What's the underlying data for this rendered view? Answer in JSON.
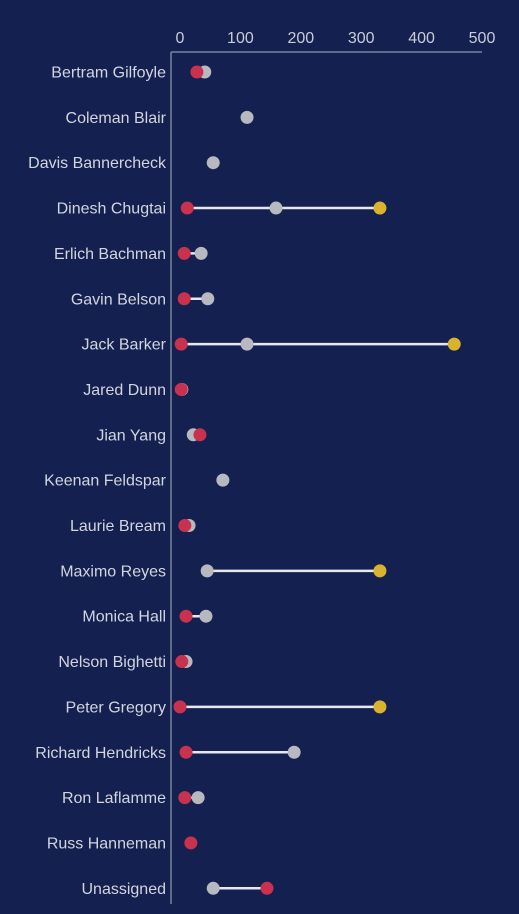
{
  "chart_data": {
    "type": "dumbbell",
    "title": "",
    "xlabel": "",
    "ylabel": "",
    "xlim": [
      0,
      500
    ],
    "x_ticks": [
      "0",
      "100",
      "200",
      "300",
      "400",
      "500"
    ],
    "x_tick_values": [
      0,
      100,
      200,
      300,
      400,
      500
    ],
    "x_axis_position": "top",
    "grid": false,
    "legend": "none",
    "colors": {
      "background": "#142150",
      "red": "#C8324F",
      "grey": "#B7B9C0",
      "gold": "#D9B32E",
      "connector": "#E6E8EE",
      "axis": "#7A849E"
    },
    "series_names": [
      "red",
      "grey",
      "gold"
    ],
    "categories": [
      "Bertram Gilfoyle",
      "Coleman Blair",
      "Davis Bannercheck",
      "Dinesh Chugtai",
      "Erlich Bachman",
      "Gavin Belson",
      "Jack Barker",
      "Jared Dunn",
      "Jian Yang",
      "Keenan Feldspar",
      "Laurie Bream",
      "Maximo Reyes",
      "Monica Hall",
      "Nelson Bighetti",
      "Peter Gregory",
      "Richard Hendricks",
      "Ron Laflamme",
      "Russ Hanneman",
      "Unassigned"
    ],
    "series": [
      {
        "name": "red",
        "values": [
          28,
          null,
          null,
          12,
          7,
          7,
          2,
          2,
          33,
          null,
          8,
          null,
          10,
          3,
          0,
          10,
          8,
          18,
          144
        ]
      },
      {
        "name": "grey",
        "values": [
          41,
          111,
          55,
          159,
          35,
          46,
          111,
          3,
          22,
          71,
          15,
          45,
          43,
          10,
          null,
          189,
          30,
          null,
          55
        ]
      },
      {
        "name": "gold",
        "values": [
          null,
          null,
          null,
          331,
          null,
          null,
          454,
          null,
          null,
          null,
          null,
          331,
          null,
          null,
          331,
          null,
          null,
          null,
          null
        ]
      }
    ]
  }
}
